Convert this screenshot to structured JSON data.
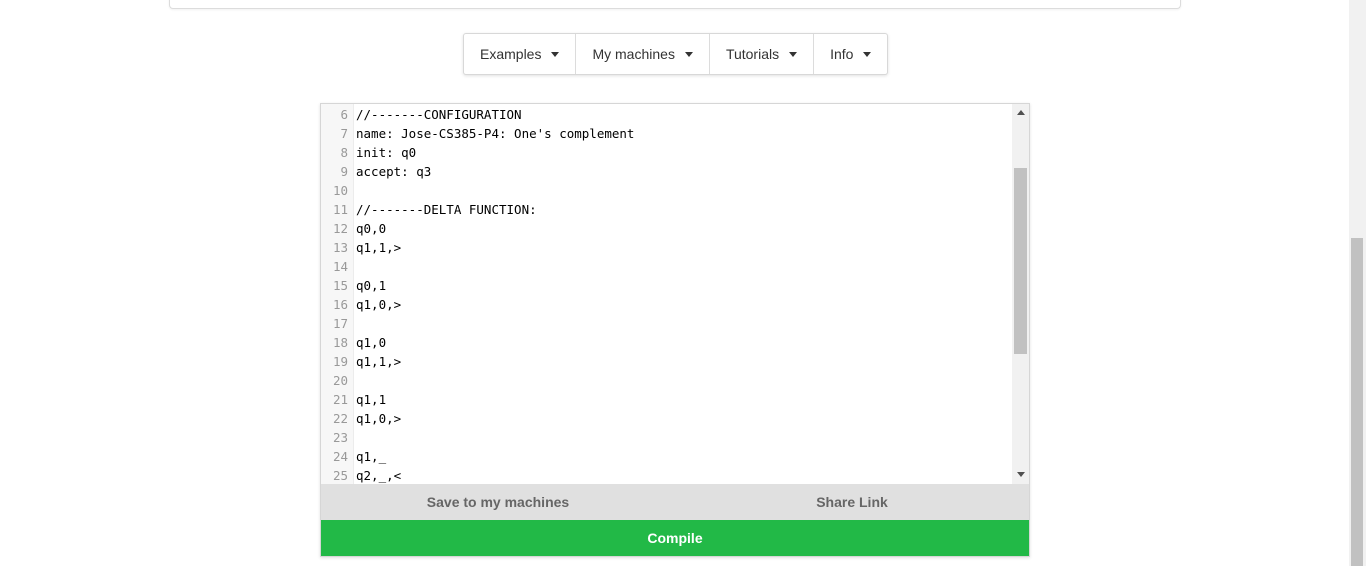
{
  "menu": {
    "items": [
      {
        "label": "Examples"
      },
      {
        "label": "My machines"
      },
      {
        "label": "Tutorials"
      },
      {
        "label": "Info"
      }
    ]
  },
  "editor": {
    "lines": [
      {
        "num": "6",
        "text": "//-------CONFIGURATION"
      },
      {
        "num": "7",
        "text": "name: Jose-CS385-P4: One's complement"
      },
      {
        "num": "8",
        "text": "init: q0"
      },
      {
        "num": "9",
        "text": "accept: q3"
      },
      {
        "num": "10",
        "text": ""
      },
      {
        "num": "11",
        "text": "//-------DELTA FUNCTION:"
      },
      {
        "num": "12",
        "text": "q0,0"
      },
      {
        "num": "13",
        "text": "q1,1,>"
      },
      {
        "num": "14",
        "text": ""
      },
      {
        "num": "15",
        "text": "q0,1"
      },
      {
        "num": "16",
        "text": "q1,0,>"
      },
      {
        "num": "17",
        "text": ""
      },
      {
        "num": "18",
        "text": "q1,0"
      },
      {
        "num": "19",
        "text": "q1,1,>"
      },
      {
        "num": "20",
        "text": ""
      },
      {
        "num": "21",
        "text": "q1,1"
      },
      {
        "num": "22",
        "text": "q1,0,>"
      },
      {
        "num": "23",
        "text": ""
      },
      {
        "num": "24",
        "text": "q1,_"
      },
      {
        "num": "25",
        "text": "q2,_,<"
      }
    ]
  },
  "actions": {
    "save_label": "Save to my machines",
    "share_label": "Share Link",
    "compile_label": "Compile"
  },
  "colors": {
    "compile": "#22b947",
    "action_row": "#e0e0e0"
  },
  "icons": [
    "caret-down-icon",
    "scroll-up-arrow-icon",
    "scroll-down-arrow-icon"
  ]
}
